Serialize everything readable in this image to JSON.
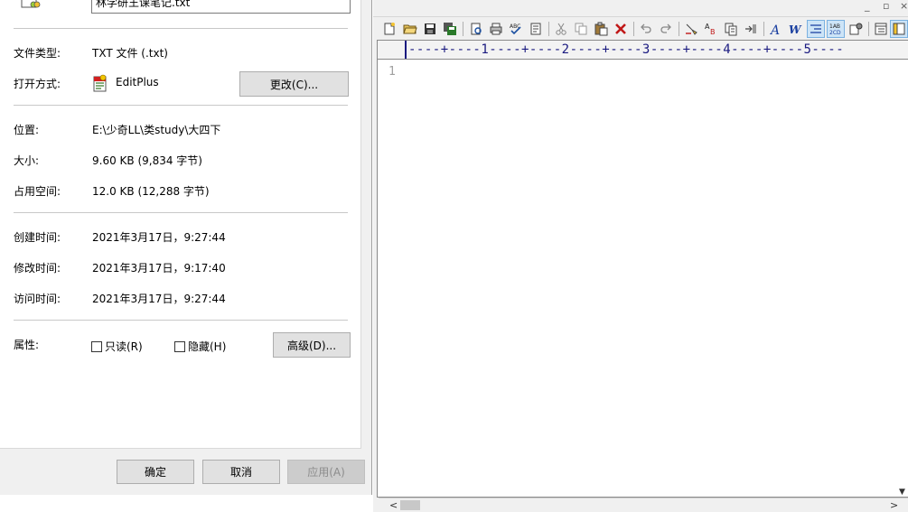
{
  "dialog": {
    "filename": "林学研王课笔记.txt",
    "rows": {
      "file_type": {
        "label": "文件类型:",
        "value": "TXT 文件 (.txt)"
      },
      "open_with": {
        "label": "打开方式:",
        "value": "EditPlus",
        "button": "更改(C)..."
      },
      "location": {
        "label": "位置:",
        "value": "E:\\少奇LL\\类study\\大四下"
      },
      "size": {
        "label": "大小:",
        "value": "9.60 KB (9,834 字节)"
      },
      "size_on_disk": {
        "label": "占用空间:",
        "value": "12.0 KB (12,288 字节)"
      },
      "created": {
        "label": "创建时间:",
        "value": "2021年3月17日，9:27:44"
      },
      "modified": {
        "label": "修改时间:",
        "value": "2021年3月17日，9:17:40"
      },
      "accessed": {
        "label": "访问时间:",
        "value": "2021年3月17日，9:27:44"
      },
      "attributes": {
        "label": "属性:",
        "readonly": "只读(R)",
        "hidden": "隐藏(H)",
        "advanced": "高级(D)..."
      }
    },
    "buttons": {
      "ok": "确定",
      "cancel": "取消",
      "apply": "应用(A)"
    }
  },
  "editor": {
    "window_controls": [
      "_",
      "▫",
      "×"
    ],
    "ruler": "----+----1----+----2----+----3----+----4----+----5----",
    "line_numbers": [
      "1"
    ],
    "toolbar_icons": [
      "new-file-icon",
      "open-folder-icon",
      "save-icon",
      "save-all-icon",
      "print-preview-icon",
      "print-icon",
      "spellcheck-icon",
      "view-icon",
      "cut-icon",
      "copy-icon",
      "paste-icon",
      "delete-icon",
      "undo-icon",
      "redo-icon",
      "find-icon",
      "replace-icon",
      "copy-format-icon",
      "indent-icon",
      "font-icon",
      "word-wrap-icon",
      "line-number-icon",
      "ruler-icon",
      "settings-icon",
      "toggle-panel-icon",
      "window-icon"
    ]
  }
}
